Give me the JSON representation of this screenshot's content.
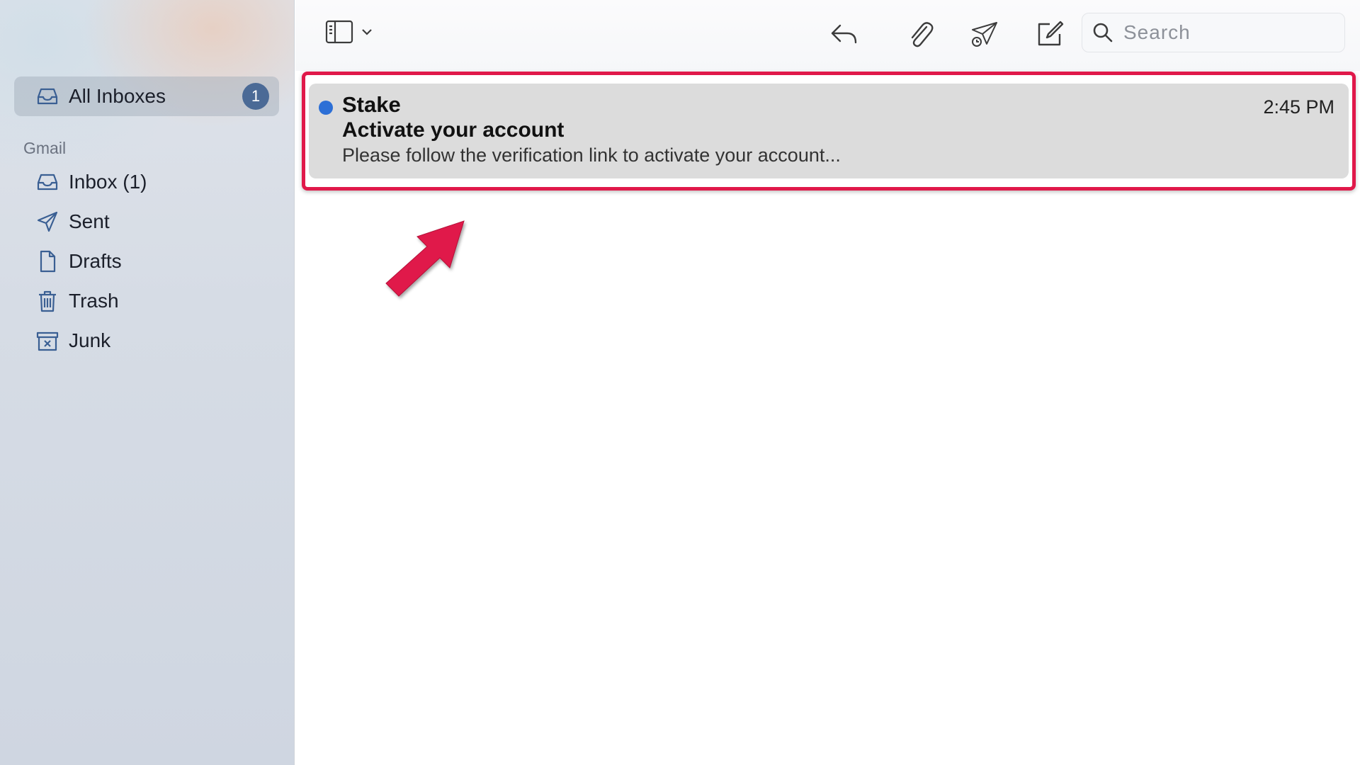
{
  "sidebar": {
    "all_inboxes": {
      "label": "All Inboxes",
      "badge": "1",
      "icon": "tray-icon"
    },
    "section_title": "Gmail",
    "items": [
      {
        "label": "Inbox (1)",
        "icon": "tray-icon"
      },
      {
        "label": "Sent",
        "icon": "paper-plane-icon"
      },
      {
        "label": "Drafts",
        "icon": "document-icon"
      },
      {
        "label": "Trash",
        "icon": "trash-icon"
      },
      {
        "label": "Junk",
        "icon": "junk-box-icon"
      }
    ]
  },
  "toolbar": {
    "buttons": [
      "sidebar-toggle-icon",
      "reply-icon",
      "attachment-icon",
      "send-later-icon",
      "compose-icon"
    ],
    "search": {
      "placeholder": "Search",
      "value": ""
    }
  },
  "messages": [
    {
      "sender": "Stake",
      "subject": "Activate your account",
      "preview": "Please follow the verification link to activate your account...",
      "time": "2:45 PM",
      "unread": true
    }
  ],
  "colors": {
    "highlight": "#e0194a",
    "unread_dot": "#2c6fd6",
    "badge": "#4b6a96",
    "selected_row": "#dcdcdc"
  }
}
